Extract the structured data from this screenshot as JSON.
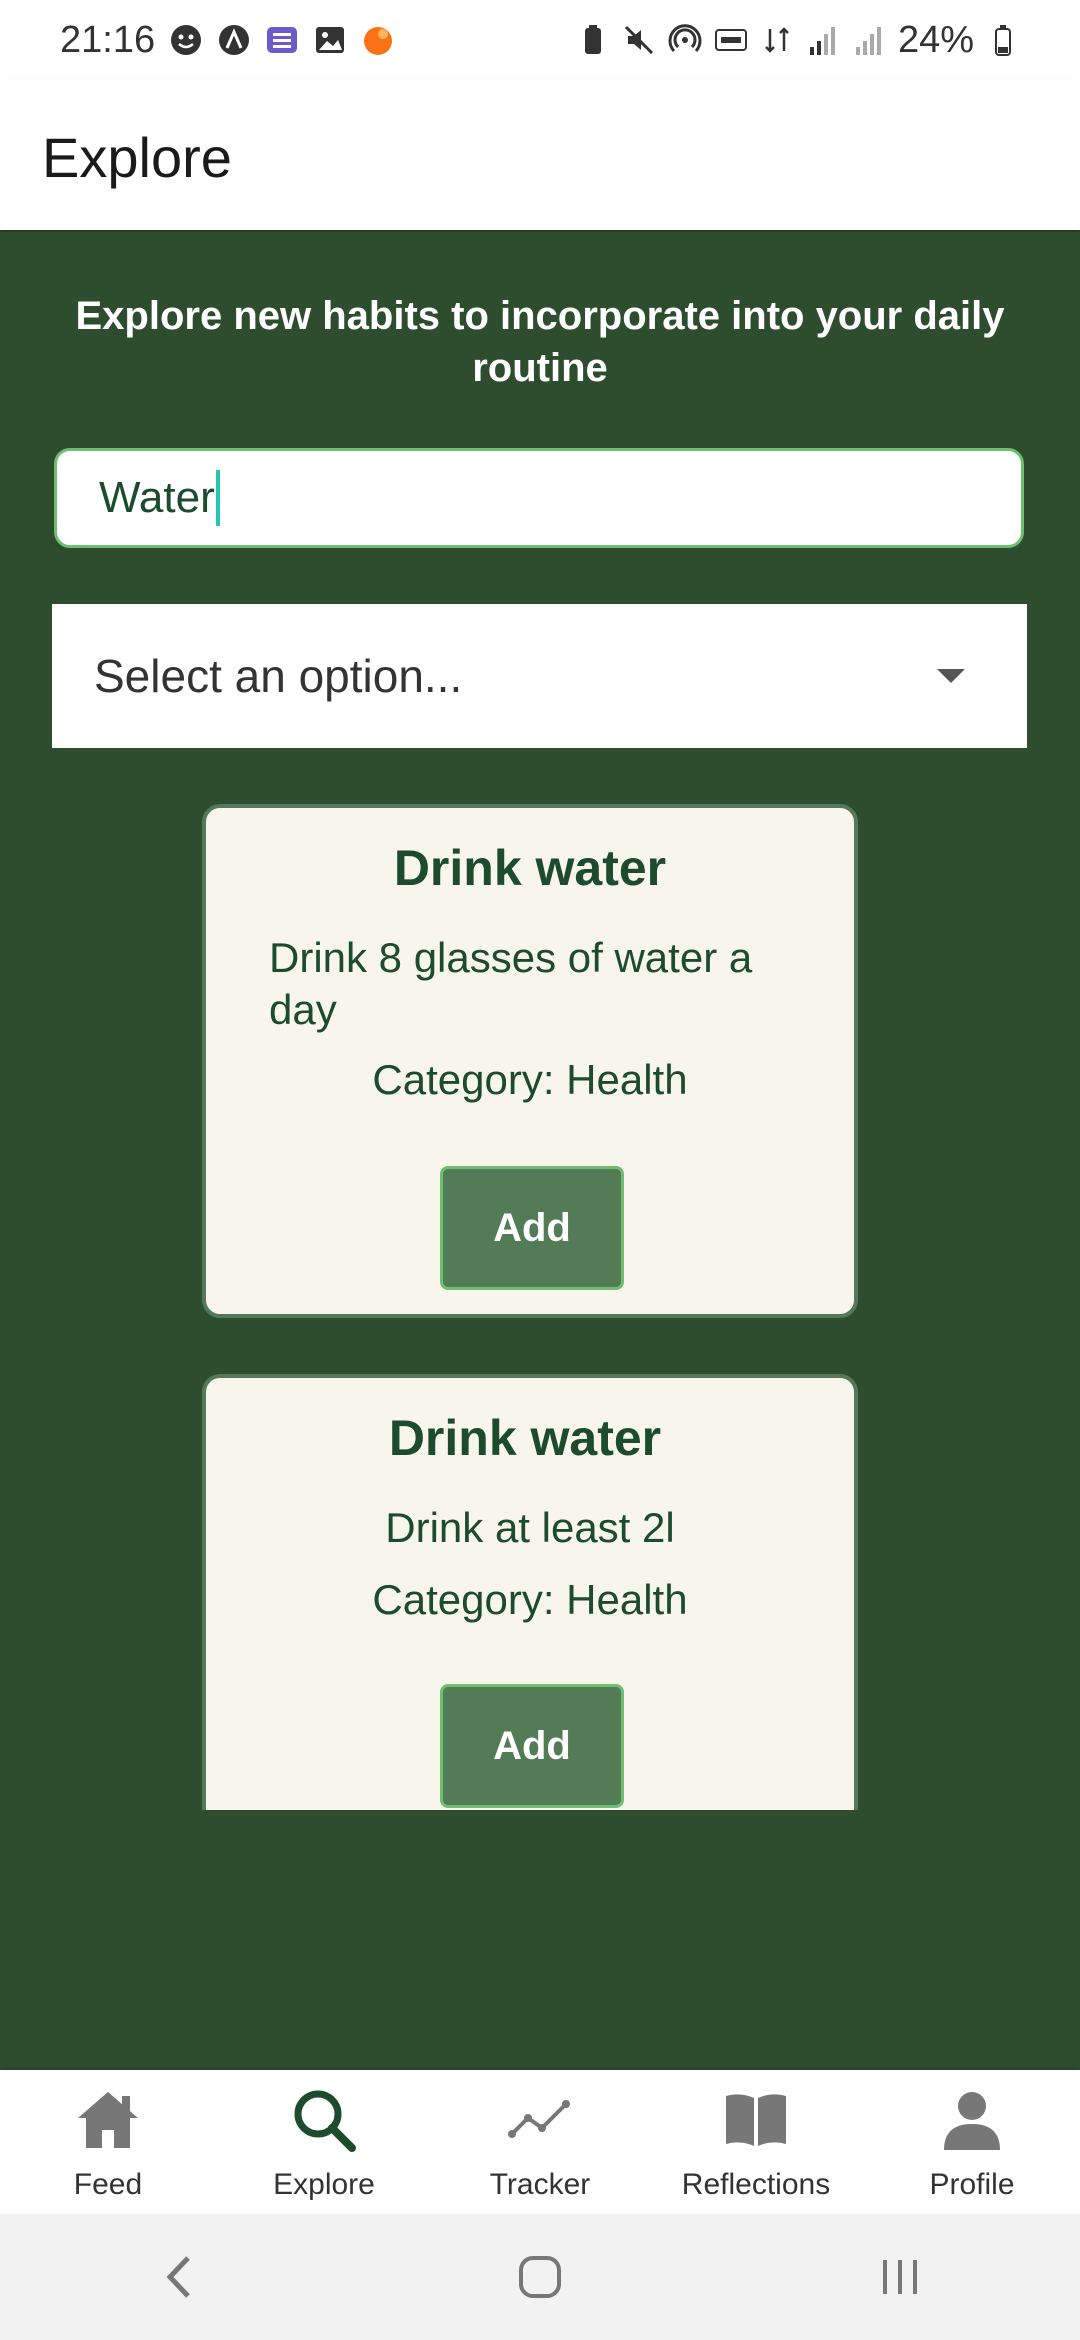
{
  "status_bar": {
    "time": "21:16",
    "battery": "24%"
  },
  "header": {
    "title": "Explore"
  },
  "explore": {
    "intro": "Explore new habits to incorporate into your daily routine",
    "search_value": "Water",
    "select_value": "Select an option..."
  },
  "habits": [
    {
      "title": "Drink water",
      "description": "Drink 8 glasses of water a day",
      "category": "Category: Health",
      "button": "Add"
    },
    {
      "title": "Drink water",
      "description": "Drink at least 2l",
      "category": "Category: Health",
      "button": "Add"
    }
  ],
  "nav": {
    "items": [
      {
        "label": "Feed",
        "icon": "home-icon"
      },
      {
        "label": "Explore",
        "icon": "search-icon",
        "active": true
      },
      {
        "label": "Tracker",
        "icon": "chart-line-icon"
      },
      {
        "label": "Reflections",
        "icon": "book-icon"
      },
      {
        "label": "Profile",
        "icon": "person-icon"
      }
    ]
  },
  "colors": {
    "primary": "#2e4d2e",
    "accent": "#1d4b2e",
    "card_bg": "#f8f5ec",
    "button": "#527b56",
    "nav_inactive": "#777777"
  }
}
